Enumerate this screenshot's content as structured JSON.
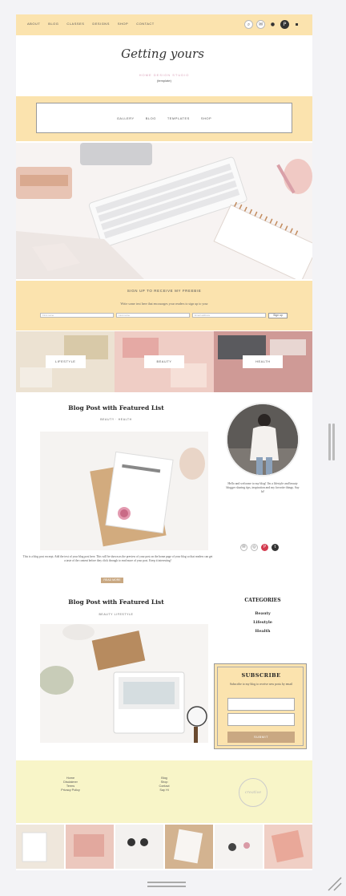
{
  "nav": {
    "items": [
      "ABOUT",
      "BLOG",
      "CLASSES",
      "DESIGNS",
      "SHOP",
      "CONTACT"
    ]
  },
  "social": {
    "icons": [
      "search-icon",
      "email-icon",
      "user-icon",
      "pinterest-icon",
      "cart-icon"
    ]
  },
  "logo": {
    "script": "Getting yours",
    "tagline": "HOME DESIGN STUDIO",
    "sub": "(template)"
  },
  "menu": {
    "items": [
      "GALLERY",
      "BLOG",
      "TEMPLATES",
      "SHOP"
    ]
  },
  "optin": {
    "title": "SIGN UP TO RECEIVE MY FREEBIE",
    "subtitle": "Write some text here that encourages your readers to sign up to your",
    "fields": [
      "First name",
      "Last name",
      "Email address"
    ],
    "button": "Sign up"
  },
  "categories": [
    "LIFESTYLE",
    "BEAUTY",
    "HEALTH"
  ],
  "posts": [
    {
      "title": "Blog Post with Featured List",
      "meta": "BEAUTY  ·  HEALTH",
      "excerpt": "This is a blog post excerpt. Add the text of your blog post here. This will be shown as the preview of your post on the home page of your blog so that readers can get a taste of the content before they click through to read more of your post. Keep it interesting!",
      "readmore": "READ MORE"
    },
    {
      "title": "Blog Post with Featured List",
      "meta": "BEAUTY  LIFESTYLE",
      "excerpt": "",
      "readmore": ""
    }
  ],
  "sidebar": {
    "bio": "Hello and welcome to my blog! I'm a lifestyle and beauty blogger sharing tips, inspiration and my favorite things. Say hi!",
    "icons": [
      "email-icon",
      "instagram-icon",
      "pinterest-icon",
      "twitter-icon"
    ],
    "categories_title": "CATEGORIES",
    "categories": [
      "Beauty",
      "Lifestyle",
      "Health"
    ],
    "subscribe": {
      "title": "SUBSCRIBE",
      "text": "Subscribe to my blog to receive new posts by email",
      "button": "SUBMIT"
    }
  },
  "footer": {
    "col1": [
      "Home",
      "Disclaimer",
      "Terms",
      "Privacy Policy"
    ],
    "col2": [
      "Blog",
      "Shop",
      "Contact",
      "Say Hi"
    ],
    "logo": "creative"
  },
  "colors": {
    "accent": "#fbe3ae",
    "button": "#c9a882",
    "footer": "#f8f5c8"
  }
}
